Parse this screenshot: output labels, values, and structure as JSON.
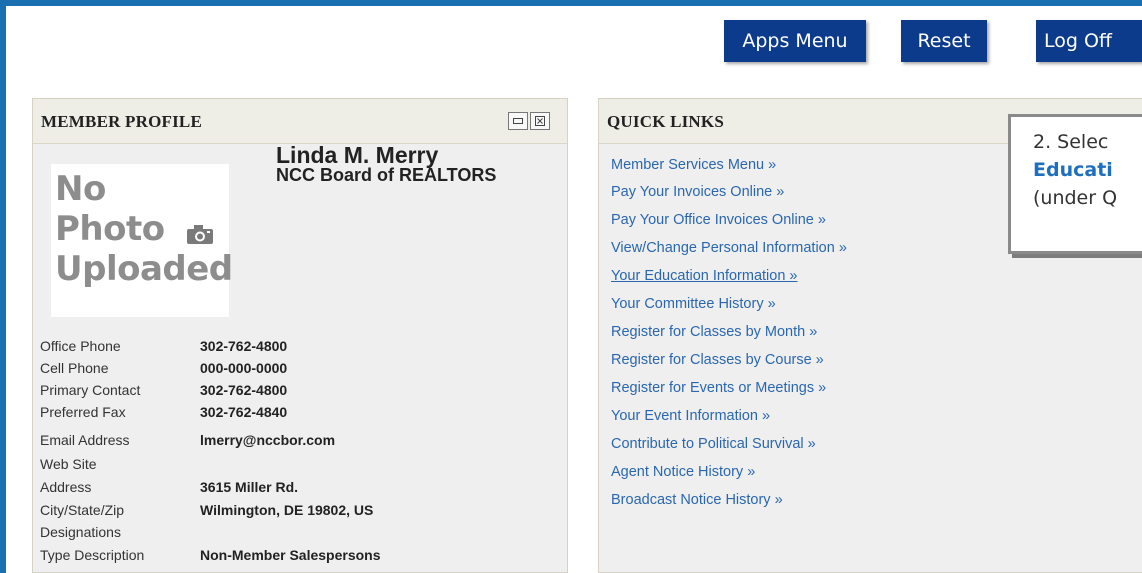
{
  "header": {
    "apps_menu_label": "Apps Menu",
    "reset_label": "Reset",
    "log_off_label": "Log Off"
  },
  "member_profile": {
    "title": "MEMBER PROFILE",
    "photo_placeholder": [
      "No",
      "Photo",
      "Uploaded"
    ],
    "name": "Linda M. Merry",
    "organization": "NCC Board of REALTORS",
    "fields": [
      {
        "label": "Office Phone",
        "value": "302-762-4800"
      },
      {
        "label": "Cell Phone",
        "value": "000-000-0000"
      },
      {
        "label": "Primary Contact",
        "value": "302-762-4800"
      },
      {
        "label": "Preferred Fax",
        "value": "302-762-4840"
      },
      {
        "label": "Email Address",
        "value": "lmerry@nccbor.com"
      },
      {
        "label": "Web Site",
        "value": ""
      },
      {
        "label": "Address",
        "value": "3615 Miller Rd."
      },
      {
        "label": "City/State/Zip",
        "value": "Wilmington, DE 19802, US"
      },
      {
        "label": "Designations",
        "value": ""
      },
      {
        "label": "Type Description",
        "value": "Non-Member Salespersons"
      }
    ]
  },
  "quick_links": {
    "title": "QUICK LINKS",
    "links": [
      "Member Services Menu »",
      "Pay Your Invoices Online »",
      "Pay Your Office Invoices Online »",
      "View/Change Personal Information »",
      "Your Education Information »",
      "Your Committee History »",
      "Register for Classes by Month »",
      "Register for Classes by Course »",
      "Register for Events or Meetings »",
      "Your Event Information »",
      "Contribute to Political Survival »",
      "Agent Notice History »",
      "Broadcast Notice History »"
    ]
  },
  "callout": {
    "line1": "2.  Selec",
    "line2": "Educati",
    "line3": "(under Q"
  },
  "colors": {
    "frame": "#1a6fb0",
    "button_bg": "#0d3b8c",
    "link": "#2a67b0",
    "callout_highlight": "#1f6fc0"
  },
  "icons": {
    "minimize": "minimize-icon",
    "close": "close-icon",
    "camera": "camera-icon"
  }
}
